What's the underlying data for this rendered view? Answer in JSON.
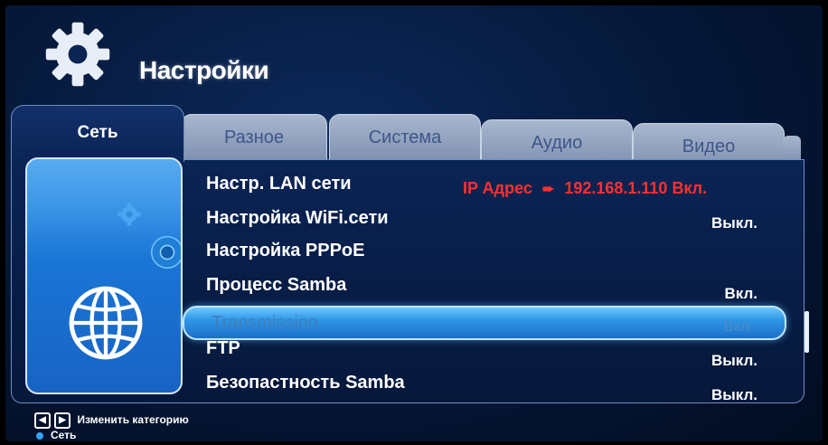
{
  "header": {
    "title": "Настройки",
    "icon": "gear-icon"
  },
  "tabs": {
    "active": "Сеть",
    "items": [
      "Разное",
      "Система",
      "Аудио",
      "Видео"
    ]
  },
  "ip_info": {
    "label": "IP Адрес",
    "value": "192.168.1.110 Вкл."
  },
  "menu": [
    {
      "label": "Настр. LAN сети",
      "value": ""
    },
    {
      "label": "Настройка WiFi.сети",
      "value": "Выкл."
    },
    {
      "label": "Настройка PPPoE",
      "value": ""
    },
    {
      "label": "Процесс Samba",
      "value": "Вкл."
    },
    {
      "label": "Transmission",
      "value": "Вкл.",
      "selected": true
    },
    {
      "label": "FTP",
      "value": "Выкл."
    },
    {
      "label": "Безопастность Samba",
      "value": "Выкл."
    }
  ],
  "footer": {
    "hint": "Изменить категорию",
    "current": "Сеть"
  },
  "colors": {
    "accent": "#2f96e6",
    "ip_text": "#ff3030",
    "tab_inactive": "#a9b7cf"
  }
}
